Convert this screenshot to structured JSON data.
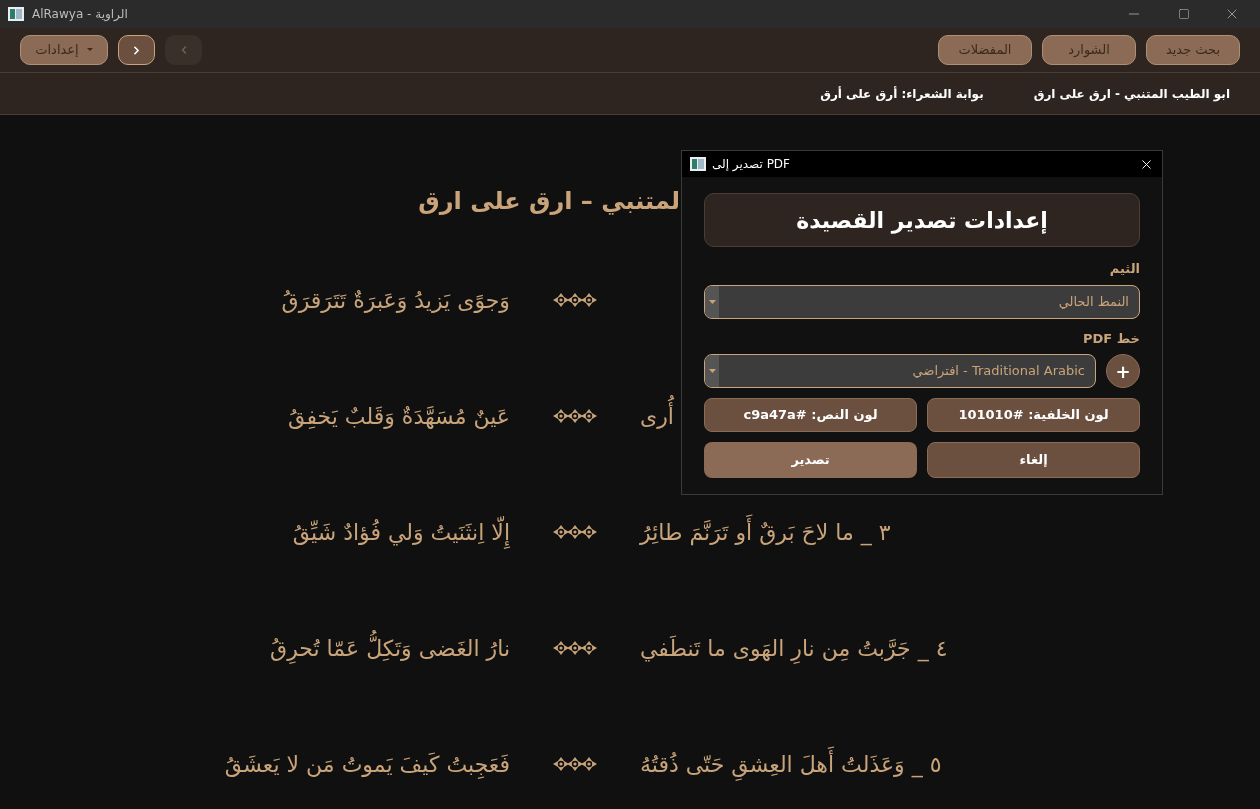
{
  "window": {
    "title": "AlRawya - الراوية"
  },
  "toolbar": {
    "right_buttons": [
      {
        "label": "بحث جديد"
      },
      {
        "label": "الشوارد"
      },
      {
        "label": "المفضلات"
      }
    ],
    "settings": {
      "label": "إعدادات"
    },
    "nav": [
      {
        "kind": "forward",
        "disabled": false
      },
      {
        "kind": "back",
        "disabled": true
      }
    ]
  },
  "breadcrumbs": [
    "ابو الطيب المتنبي - ارق على ارق",
    "بوابة الشعراء: أرق على أرق"
  ],
  "poem": {
    "title": "لمتنبي – ارق على ارق",
    "verses": [
      {
        "second": "وَجوًى يَزيدُ وَعَبرَةٌ تَتَرَقرَقُ"
      },
      {
        "first": "أُرى",
        "second": "عَينٌ مُسَهَّدَةٌ وَقَلبٌ يَخفِقُ"
      },
      {
        "first": "٣ _ ما لاحَ بَرقٌ أَو تَرَنَّمَ طائِرُ",
        "second": "إِلّا اِنثَنَيتُ وَلي فُؤادٌ شَيِّقُ"
      },
      {
        "first": "٤ _ جَرَّبتُ مِن نارِ الهَوى ما تَنطَفي",
        "second": "نارُ الغَضى وَتَكِلُّ عَمّا تُحرِقُ"
      },
      {
        "first": "٥ _ وَعَذَلتُ أَهلَ العِشقِ حَتّى ذُقتُهُ",
        "second": "فَعَجِبتُ كَيفَ يَموتُ مَن لا يَعشَقُ"
      }
    ]
  },
  "dialog": {
    "title": "تصدير إلى PDF",
    "heading": "إعدادات تصدير القصيدة",
    "theme_label": "الثيم",
    "theme_value": "النمط الحالي",
    "font_label": "خط PDF",
    "font_value": "Traditional Arabic - افتراضي",
    "add_font": "+",
    "color_buttons": [
      "لون الخلفية: #101010",
      "لون النص: #c9a47a"
    ],
    "actions": [
      {
        "kind": "cancel",
        "label": "إلغاء"
      },
      {
        "kind": "export",
        "label": "تصدير"
      }
    ]
  }
}
